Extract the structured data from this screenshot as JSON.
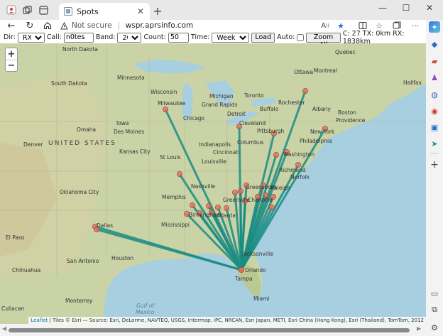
{
  "browser": {
    "tab_title": "Spots",
    "new_tab": "+",
    "security_label": "Not secure",
    "url": "wspr.aprsinfo.com"
  },
  "toolbar": {
    "dir_label": "Dir:",
    "dir_value": "RX/TX",
    "call_label": "Call:",
    "call_value": "n0tes",
    "band_label": "Band:",
    "band_value": "20m",
    "count_label": "Count:",
    "count_value": "50",
    "time_label": "Time:",
    "time_value": "Week",
    "load_label": "Load",
    "auto_label": "Auto:",
    "zoom_all_label": "Zoom All",
    "stats": "C: 27 TX: 0km RX: 1838km"
  },
  "map": {
    "zoom_in": "+",
    "zoom_out": "−",
    "attribution_link": "Leaflet",
    "attribution_text": " | Tiles © Esri — Source: Esri, DeLorme, NAVTEQ, USGS, Intermap, iPC, NRCAN, Esri Japan, METI, Esri China (Hong Kong), Esri (Thailand), TomTom, 2012",
    "colors": {
      "path": "#1a8c84",
      "marker": "#e0705f",
      "land": "#c8d2a4",
      "water": "#a8cfe0"
    },
    "labels": {
      "north_dakota": "North Dakota",
      "minnesota": "Minnesota",
      "quebec": "Quebec",
      "ottawa": "Ottawa",
      "montreal": "Montreal",
      "halifax": "Halifax",
      "south_dakota": "South Dakota",
      "wisconsin": "Wisconsin",
      "michigan": "Michigan",
      "toronto": "Toronto",
      "rochester": "Rochester",
      "buffalo": "Buffalo",
      "albany": "Albany",
      "boston": "Boston",
      "providence": "Providence",
      "grand_rapids": "Grand Rapids",
      "milwaukee": "Milwaukee",
      "chicago": "Chicago",
      "detroit": "Detroit",
      "cleveland": "Cleveland",
      "iowa": "Iowa",
      "omaha": "Omaha",
      "des_moines": "Des Moines",
      "pittsburgh": "Pittsburgh",
      "new_york": "New York",
      "philadelphia": "Philadelphia",
      "denver": "Denver",
      "united_states": "UNITED STATES",
      "indianapolis": "Indianapolis",
      "columbus": "Columbus",
      "washington": "Washington",
      "kansas_city": "Kansas City",
      "st_louis": "St Louis",
      "cincinnati": "Cincinnati",
      "louisville": "Louisville",
      "richmond": "Richmond",
      "norfolk": "Norfolk",
      "oklahoma_city": "Oklahoma City",
      "nashville": "Nashville",
      "greensboro": "Greensboro",
      "raleigh": "Raleigh",
      "charlotte": "Charlotte",
      "memphis": "Memphis",
      "greenville": "Greenville",
      "atlanta": "Atlanta",
      "birmingham": "Birmingham",
      "mississippi": "Mississippi",
      "el_paso": "El Paso",
      "dallas": "Dallas",
      "jacksonville": "Jacksonville",
      "san_antonio": "San Antonio",
      "houston": "Houston",
      "orlando": "Orlando",
      "tampa": "Tampa",
      "chihuahua": "Chihuahua",
      "monterrey": "Monterrey",
      "gulf_of": "Gulf of",
      "mexico": "Mexico",
      "miami": "Miami",
      "culiacan": "Culiacan"
    },
    "receiver": {
      "name": "Tampa"
    },
    "spot_count": 27
  }
}
